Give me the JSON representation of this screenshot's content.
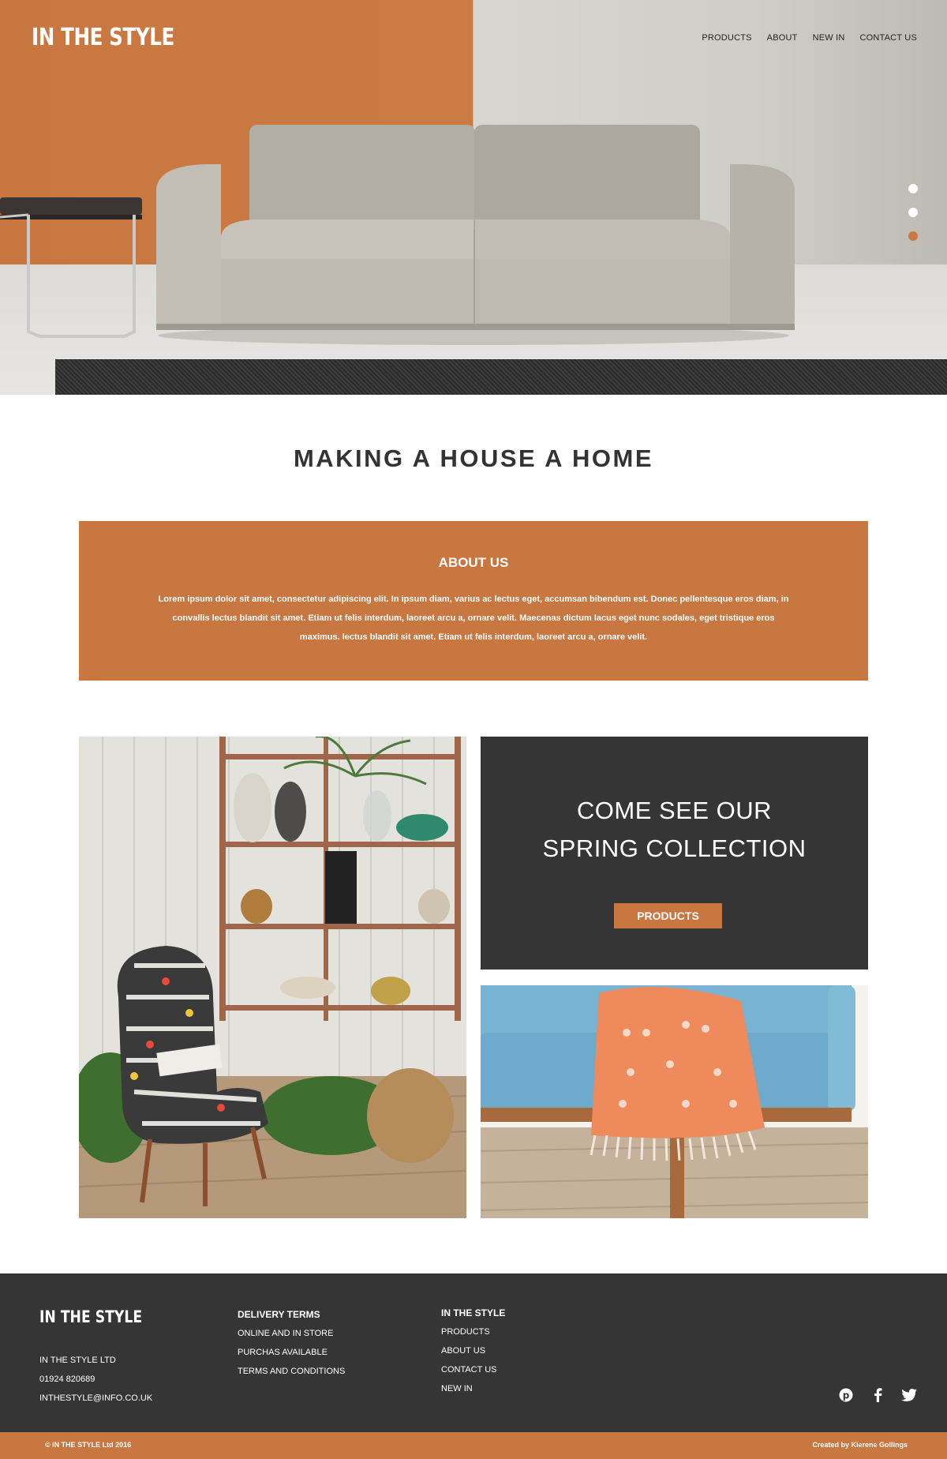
{
  "brand": "IN THE STYLE",
  "nav": {
    "items": [
      "PRODUCTS",
      "ABOUT",
      "NEW IN",
      "CONTACT US"
    ]
  },
  "hero": {
    "slides_total": 3,
    "active_slide": 3
  },
  "headline": "MAKING A HOUSE A HOME",
  "about": {
    "title": "ABOUT US",
    "body": "Lorem ipsum dolor sit amet, consectetur adipiscing elit. In ipsum diam, varius ac lectus eget, accumsan bibendum est. Donec pellentesque eros diam, in convallis lectus blandit sit amet. Etiam ut felis interdum, laoreet arcu a, ornare velit. Maecenas dictum lacus eget nunc sodales, eget tristique eros maximus. lectus blandit sit amet. Etiam ut felis interdum, laoreet arcu a, ornare velit."
  },
  "promo": {
    "line1": "COME SEE OUR",
    "line2": "SPRING COLLECTION",
    "button": "PRODUCTS"
  },
  "footer": {
    "logo": "IN THE STYLE",
    "company": [
      "IN THE STYLE LTD",
      "01924 820689",
      "INTHESTYLE@INFO.CO.UK"
    ],
    "delivery": {
      "title": "DELIVERY TERMS",
      "items": [
        "ONLINE AND IN STORE",
        "PURCHAS AVAILABLE",
        "TERMS AND CONDITIONS"
      ]
    },
    "links": {
      "title": "IN THE STYLE",
      "items": [
        "PRODUCTS",
        "ABOUT US",
        "CONTACT US",
        "NEW IN"
      ]
    },
    "social": [
      "pinterest-icon",
      "facebook-icon",
      "twitter-icon"
    ],
    "copyright": "© IN THE STYLE Ltd 2016",
    "credit": "Created by Kierene Gollings"
  },
  "colors": {
    "accent": "#c97741",
    "dark": "#353535"
  }
}
